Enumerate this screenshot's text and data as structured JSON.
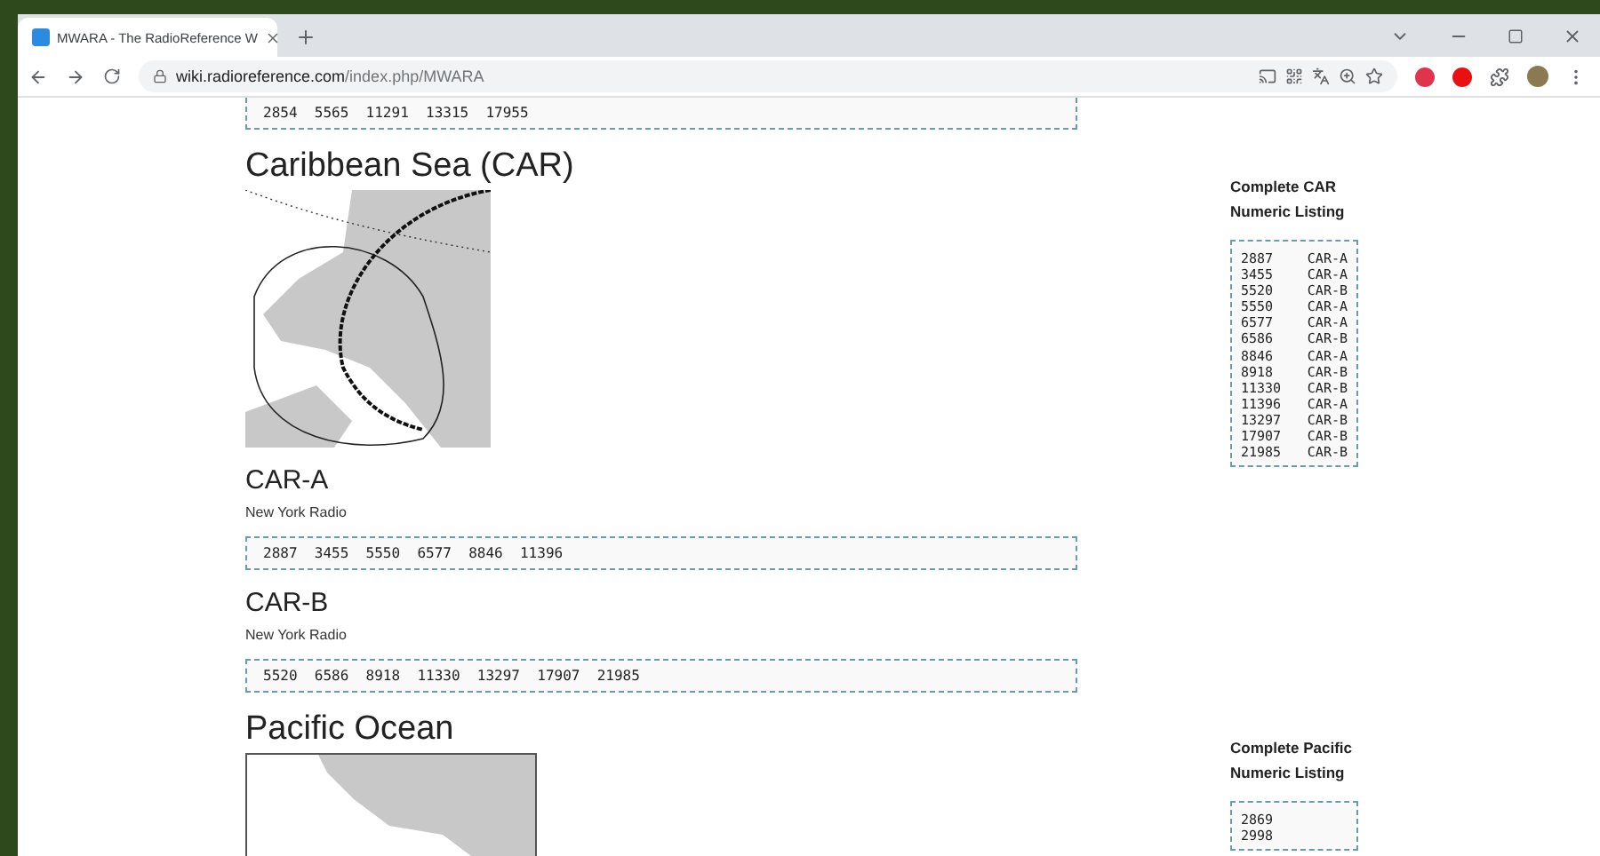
{
  "browser": {
    "tab": {
      "title": "MWARA - The RadioReference W",
      "selected": true
    },
    "url": {
      "host": "wiki.radioreference.com",
      "path": "/index.php/MWARA"
    }
  },
  "page": {
    "top_listing": "2854  5565  11291  13315  17955",
    "sections": [
      {
        "title": "Caribbean Sea (CAR)",
        "kind": "caribbean",
        "subsections": [
          {
            "title": "CAR-A",
            "station": "New York Radio",
            "frequencies": "2887  3455  5550  6577  8846  11396"
          },
          {
            "title": "CAR-B",
            "station": "New York Radio",
            "frequencies": "5520  6586  8918  11330  13297  17907  21985"
          }
        ],
        "listing": {
          "title": "Complete CAR Numeric Listing",
          "rows": [
            {
              "frequency": "2887",
              "area": "CAR-A"
            },
            {
              "frequency": "3455",
              "area": "CAR-A"
            },
            {
              "frequency": "5520",
              "area": "CAR-B"
            },
            {
              "frequency": "5550",
              "area": "CAR-A"
            },
            {
              "frequency": "6577",
              "area": "CAR-A"
            },
            {
              "frequency": "6586",
              "area": "CAR-B"
            },
            {
              "frequency": "8846",
              "area": "CAR-A"
            },
            {
              "frequency": "8918",
              "area": "CAR-B"
            },
            {
              "frequency": "11330",
              "area": "CAR-B"
            },
            {
              "frequency": "11396",
              "area": "CAR-A"
            },
            {
              "frequency": "13297",
              "area": "CAR-B"
            },
            {
              "frequency": "17907",
              "area": "CAR-B"
            },
            {
              "frequency": "21985",
              "area": "CAR-B"
            }
          ]
        }
      },
      {
        "title": "Pacific Ocean",
        "kind": "pacific",
        "listing": {
          "title": "Complete Pacific Numeric Listing",
          "rows": [
            {
              "frequency": "2869"
            },
            {
              "frequency": "2998"
            }
          ]
        }
      }
    ]
  }
}
